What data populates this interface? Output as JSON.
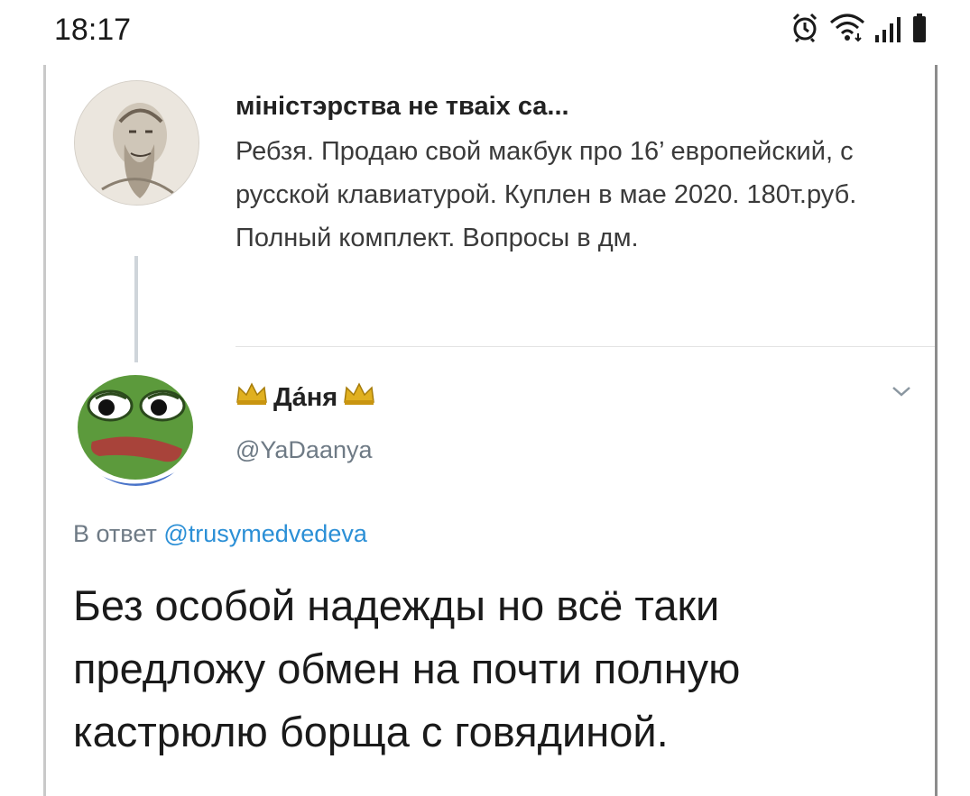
{
  "status_bar": {
    "time": "18:17",
    "icons": [
      "alarm-icon",
      "wifi-icon",
      "signal-icon",
      "battery-icon"
    ]
  },
  "tweet_parent": {
    "author_name": "міністэрства не тваіх са...",
    "text": "Ребзя. Продаю свой макбук про 16’ европейский, с русской клавиатурой. Куплен в мае 2020. 180т.руб. Полный комплект. Вопросы в дм."
  },
  "tweet_reply": {
    "author_name": "Да́ня",
    "handle": "@YaDaanya",
    "reply_prefix": "В ответ",
    "reply_handle": "@trusymedvedeva",
    "text": "Без особой надежды но всё таки предложу обмен на почти полную кастрюлю борща с говядиной."
  },
  "colors": {
    "link": "#2b8fd6",
    "muted": "#6e7a85",
    "crown": "#e0b020"
  }
}
